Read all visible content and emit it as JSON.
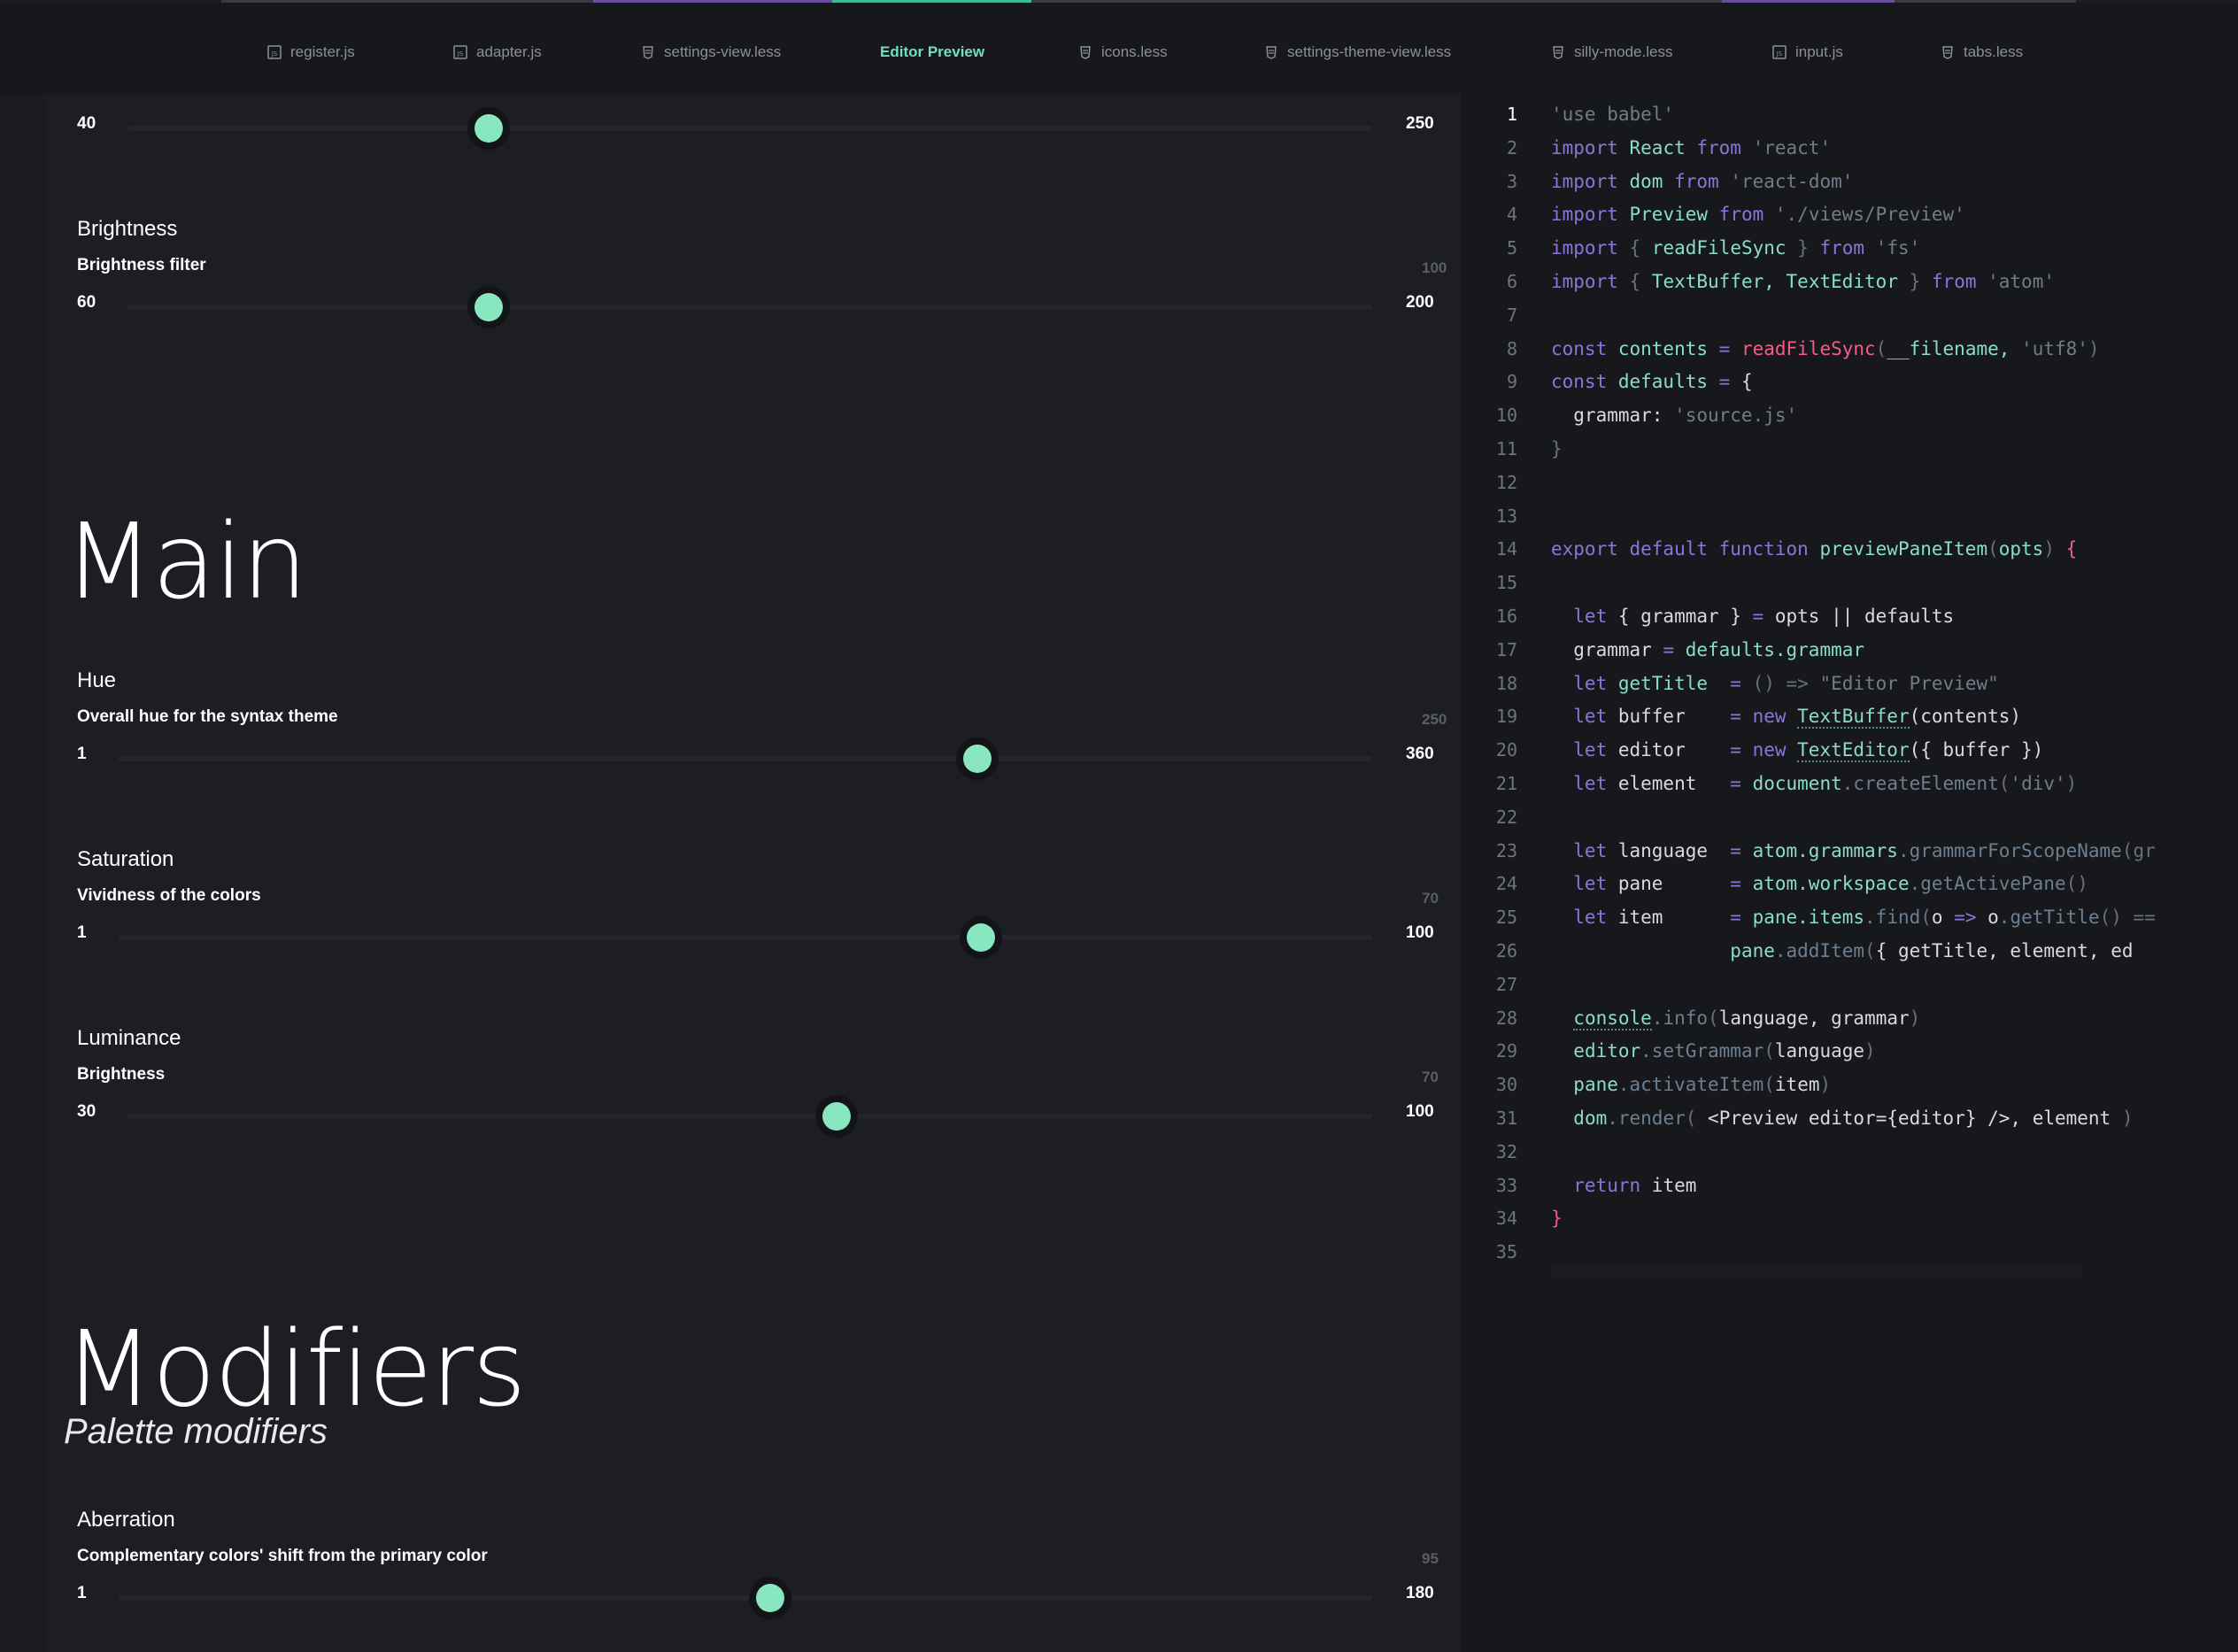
{
  "tabs": [
    {
      "label": "register.js",
      "icon": "js-file-icon"
    },
    {
      "label": "adapter.js",
      "icon": "js-file-icon"
    },
    {
      "label": "settings-view.less",
      "icon": "css-file-icon"
    },
    {
      "label": "Editor Preview",
      "icon": "",
      "active": true
    },
    {
      "label": "icons.less",
      "icon": "css-file-icon"
    },
    {
      "label": "settings-theme-view.less",
      "icon": "css-file-icon"
    },
    {
      "label": "silly-mode.less",
      "icon": "css-file-icon"
    },
    {
      "label": "input.js",
      "icon": "js-file-icon"
    },
    {
      "label": "tabs.less",
      "icon": "css-file-icon"
    }
  ],
  "settings": {
    "top_slider": {
      "min": "40",
      "max": "250",
      "fraction": 0.29
    },
    "brightness": {
      "name": "Brightness",
      "desc": "Brightness filter",
      "min": "60",
      "max": "200",
      "current": "100",
      "fraction": 0.29
    },
    "main": {
      "title": "Main",
      "hue": {
        "name": "Hue",
        "desc": "Overall hue for the syntax theme",
        "min": "1",
        "max": "360",
        "current": "250",
        "fraction": 0.685
      },
      "saturation": {
        "name": "Saturation",
        "desc": "Vividness of the colors",
        "min": "1",
        "max": "100",
        "current": "70",
        "fraction": 0.688
      },
      "luminance": {
        "name": "Luminance",
        "desc": "Brightness",
        "min": "30",
        "max": "100",
        "current": "70",
        "fraction": 0.57
      }
    },
    "modifiers": {
      "title": "Modifiers",
      "subtitle": "Palette modifiers",
      "aberration": {
        "name": "Aberration",
        "desc": "Complementary colors' shift from the primary color",
        "min": "1",
        "max": "180",
        "current": "95",
        "fraction": 0.52
      }
    }
  },
  "editor": {
    "current_line": 1,
    "lines": [
      [
        [
          "s",
          "'use babel'"
        ]
      ],
      [
        [
          "k",
          "import "
        ],
        [
          "c",
          "React "
        ],
        [
          "k",
          "from "
        ],
        [
          "s",
          "'react'"
        ]
      ],
      [
        [
          "k",
          "import "
        ],
        [
          "c",
          "dom "
        ],
        [
          "k",
          "from "
        ],
        [
          "s",
          "'react-dom'"
        ]
      ],
      [
        [
          "k",
          "import "
        ],
        [
          "c",
          "Preview "
        ],
        [
          "k",
          "from "
        ],
        [
          "s",
          "'./views/Preview'"
        ]
      ],
      [
        [
          "k",
          "import "
        ],
        [
          "p",
          "{ "
        ],
        [
          "c",
          "readFileSync "
        ],
        [
          "p",
          "} "
        ],
        [
          "k",
          "from "
        ],
        [
          "s",
          "'fs'"
        ]
      ],
      [
        [
          "k",
          "import "
        ],
        [
          "p",
          "{ "
        ],
        [
          "c",
          "TextBuffer, TextEditor "
        ],
        [
          "p",
          "} "
        ],
        [
          "k",
          "from "
        ],
        [
          "s",
          "'atom'"
        ]
      ],
      [],
      [
        [
          "k",
          "const "
        ],
        [
          "c",
          "contents "
        ],
        [
          "k",
          "= "
        ],
        [
          "f",
          "readFileSync"
        ],
        [
          "p",
          "("
        ],
        [
          "c",
          "__filename, "
        ],
        [
          "s",
          "'utf8'"
        ],
        [
          "p",
          ")"
        ]
      ],
      [
        [
          "k",
          "const "
        ],
        [
          "c",
          "defaults "
        ],
        [
          "k",
          "= "
        ],
        [
          "v",
          "{"
        ]
      ],
      [
        [
          "v",
          "  grammar: "
        ],
        [
          "s",
          "'source.js'"
        ]
      ],
      [
        [
          "p",
          "}"
        ]
      ],
      [],
      [],
      [
        [
          "k",
          "export default function "
        ],
        [
          "c",
          "previewPaneItem"
        ],
        [
          "p",
          "("
        ],
        [
          "c",
          "opts"
        ],
        [
          "p",
          ") "
        ],
        [
          "f",
          "{"
        ]
      ],
      [],
      [
        [
          "k",
          "  let "
        ],
        [
          "v",
          "{ grammar } "
        ],
        [
          "k",
          "= "
        ],
        [
          "v",
          "opts || defaults"
        ]
      ],
      [
        [
          "v",
          "  grammar "
        ],
        [
          "k",
          "= "
        ],
        [
          "c",
          "defaults.grammar"
        ]
      ],
      [
        [
          "k",
          "  let "
        ],
        [
          "c",
          "getTitle  "
        ],
        [
          "k",
          "= "
        ],
        [
          "p",
          "() => "
        ],
        [
          "s",
          "\"Editor Preview\""
        ]
      ],
      [
        [
          "k",
          "  let "
        ],
        [
          "v",
          "buffer    "
        ],
        [
          "k",
          "= new "
        ],
        [
          "u",
          "TextBuffer"
        ],
        [
          "v",
          "(contents)"
        ]
      ],
      [
        [
          "k",
          "  let "
        ],
        [
          "v",
          "editor    "
        ],
        [
          "k",
          "= new "
        ],
        [
          "u",
          "TextEditor"
        ],
        [
          "v",
          "({ buffer })"
        ]
      ],
      [
        [
          "k",
          "  let "
        ],
        [
          "v",
          "element   "
        ],
        [
          "k",
          "= "
        ],
        [
          "c",
          "document"
        ],
        [
          "m",
          ".createElement"
        ],
        [
          "p",
          "("
        ],
        [
          "s",
          "'div'"
        ],
        [
          "p",
          ")"
        ]
      ],
      [],
      [
        [
          "k",
          "  let "
        ],
        [
          "v",
          "language  "
        ],
        [
          "k",
          "= "
        ],
        [
          "c",
          "atom.grammars"
        ],
        [
          "m",
          ".grammarForScopeName"
        ],
        [
          "p",
          "(gr"
        ]
      ],
      [
        [
          "k",
          "  let "
        ],
        [
          "v",
          "pane      "
        ],
        [
          "k",
          "= "
        ],
        [
          "c",
          "atom.workspace"
        ],
        [
          "m",
          ".getActivePane"
        ],
        [
          "p",
          "()"
        ]
      ],
      [
        [
          "k",
          "  let "
        ],
        [
          "v",
          "item      "
        ],
        [
          "k",
          "= "
        ],
        [
          "c",
          "pane.items"
        ],
        [
          "m",
          ".find"
        ],
        [
          "p",
          "("
        ],
        [
          "v",
          "o "
        ],
        [
          "k",
          "=> "
        ],
        [
          "v",
          "o"
        ],
        [
          "m",
          ".getTitle"
        ],
        [
          "p",
          "() =="
        ]
      ],
      [
        [
          "v",
          "                "
        ],
        [
          "c",
          "pane"
        ],
        [
          "m",
          ".addItem"
        ],
        [
          "p",
          "("
        ],
        [
          "v",
          "{ getTitle, element, ed"
        ]
      ],
      [],
      [
        [
          "v",
          "  "
        ],
        [
          "u",
          "console"
        ],
        [
          "m",
          ".info"
        ],
        [
          "p",
          "("
        ],
        [
          "v",
          "language, grammar"
        ],
        [
          "p",
          ")"
        ]
      ],
      [
        [
          "v",
          "  "
        ],
        [
          "c",
          "editor"
        ],
        [
          "m",
          ".setGrammar"
        ],
        [
          "p",
          "("
        ],
        [
          "v",
          "language"
        ],
        [
          "p",
          ")"
        ]
      ],
      [
        [
          "v",
          "  "
        ],
        [
          "c",
          "pane"
        ],
        [
          "m",
          ".activateItem"
        ],
        [
          "p",
          "("
        ],
        [
          "v",
          "item"
        ],
        [
          "p",
          ")"
        ]
      ],
      [
        [
          "v",
          "  "
        ],
        [
          "c",
          "dom"
        ],
        [
          "m",
          ".render"
        ],
        [
          "p",
          "( "
        ],
        [
          "v",
          "<Preview editor={editor} />, element "
        ],
        [
          "p",
          ")"
        ]
      ],
      [],
      [
        [
          "k",
          "  return "
        ],
        [
          "v",
          "item"
        ]
      ],
      [
        [
          "f",
          "}"
        ]
      ],
      []
    ]
  },
  "colors": {
    "accent": "#6ee0c0",
    "thumb": "#88e6c0",
    "background": "#17181c",
    "panel": "#1d1e23"
  }
}
